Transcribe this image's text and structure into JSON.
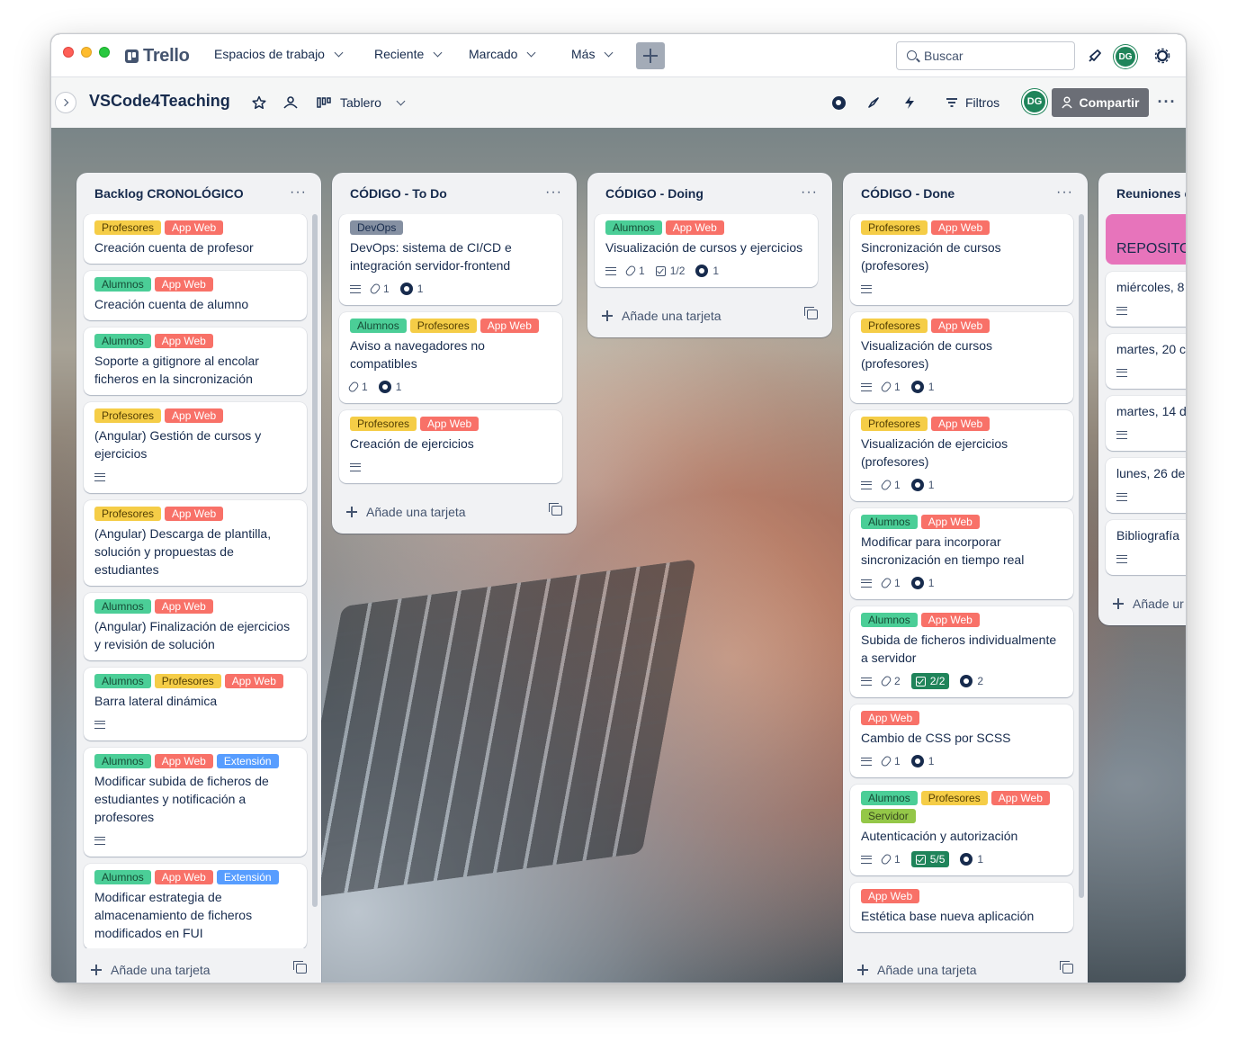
{
  "app": {
    "name": "Trello"
  },
  "nav": {
    "workspaces": "Espacios de trabajo",
    "recent": "Reciente",
    "starred": "Marcado",
    "more": "Más",
    "search_placeholder": "Buscar",
    "user_initials": "DG"
  },
  "board": {
    "title": "VSCode4Teaching",
    "view": "Tablero",
    "filters": "Filtros",
    "share": "Compartir",
    "member_initials": "DG",
    "add_card": "Añade una tarjeta"
  },
  "colors": {
    "accent_green": "#1f845a",
    "label_green": "#4bce97",
    "label_yellow": "#f5cd47",
    "label_red": "#f87168",
    "label_blue": "#579dff",
    "cover_pink": "#e774bb"
  },
  "lists": [
    {
      "title": "Backlog CRONOLÓGICO",
      "cards": [
        {
          "labels": [
            "Profesores",
            "App Web"
          ],
          "title": "Creación cuenta de profesor"
        },
        {
          "labels": [
            "Alumnos",
            "App Web"
          ],
          "title": "Creación cuenta de alumno"
        },
        {
          "labels": [
            "Alumnos",
            "App Web"
          ],
          "title": "Soporte a gitignore al encolar ficheros en la sincronización"
        },
        {
          "labels": [
            "Profesores",
            "App Web"
          ],
          "title": "(Angular) Gestión de cursos y ejercicios"
        },
        {
          "labels": [
            "Profesores",
            "App Web"
          ],
          "title": "(Angular) Descarga de plantilla, solución y propuestas de estudiantes"
        },
        {
          "labels": [
            "Alumnos",
            "App Web"
          ],
          "title": "(Angular) Finalización de ejercicios y revisión de solución"
        },
        {
          "labels": [
            "Alumnos",
            "Profesores",
            "App Web"
          ],
          "title": "Barra lateral dinámica"
        },
        {
          "labels": [
            "Alumnos",
            "App Web",
            "Extensión"
          ],
          "title": "Modificar subida de ficheros de estudiantes y notificación a profesores"
        },
        {
          "labels": [
            "Alumnos",
            "App Web",
            "Extensión"
          ],
          "title": "Modificar estrategia de almacenamiento de ficheros modificados en FUI"
        }
      ]
    },
    {
      "title": "CÓDIGO - To Do",
      "cards": [
        {
          "labels": [
            "DevOps"
          ],
          "title": "DevOps: sistema de CI/CD e integración servidor-frontend",
          "attachments": "1",
          "github": "1"
        },
        {
          "labels": [
            "Alumnos",
            "Profesores",
            "App Web"
          ],
          "title": "Aviso a navegadores no compatibles",
          "attachments": "1",
          "github": "1"
        },
        {
          "labels": [
            "Profesores",
            "App Web"
          ],
          "title": "Creación de ejercicios"
        }
      ]
    },
    {
      "title": "CÓDIGO - Doing",
      "cards": [
        {
          "labels": [
            "Alumnos",
            "App Web"
          ],
          "title": "Visualización de cursos y ejercicios",
          "attachments": "1",
          "checklist": "1/2",
          "github": "1"
        }
      ]
    },
    {
      "title": "CÓDIGO - Done",
      "cards": [
        {
          "labels": [
            "Profesores",
            "App Web"
          ],
          "title": "Sincronización de cursos (profesores)"
        },
        {
          "labels": [
            "Profesores",
            "App Web"
          ],
          "title": "Visualización de cursos (profesores)",
          "attachments": "1",
          "github": "1"
        },
        {
          "labels": [
            "Profesores",
            "App Web"
          ],
          "title": "Visualización de ejercicios (profesores)",
          "attachments": "1",
          "github": "1"
        },
        {
          "labels": [
            "Alumnos",
            "App Web"
          ],
          "title": "Modificar para incorporar sincronización en tiempo real",
          "attachments": "1",
          "github": "1"
        },
        {
          "labels": [
            "Alumnos",
            "App Web"
          ],
          "title": "Subida de ficheros individualmente a servidor",
          "attachments": "2",
          "checklist": "2/2",
          "github": "2"
        },
        {
          "labels": [
            "App Web"
          ],
          "title": "Cambio de CSS por SCSS",
          "attachments": "1",
          "github": "1"
        },
        {
          "labels": [
            "Alumnos",
            "Profesores",
            "App Web",
            "Servidor"
          ],
          "title": "Autenticación y autorización",
          "attachments": "1",
          "checklist": "5/5",
          "github": "1"
        },
        {
          "labels": [
            "App Web"
          ],
          "title": "Estética base nueva aplicación"
        }
      ]
    },
    {
      "title": "Reuniones e",
      "cover": "REPOSITO",
      "cards": [
        {
          "title": "miércoles, 8"
        },
        {
          "title": "martes, 20 c"
        },
        {
          "title": "martes, 14 d"
        },
        {
          "title": "lunes, 26 de"
        },
        {
          "title": "Bibliografía"
        }
      ],
      "add_card": "Añade ur"
    }
  ]
}
